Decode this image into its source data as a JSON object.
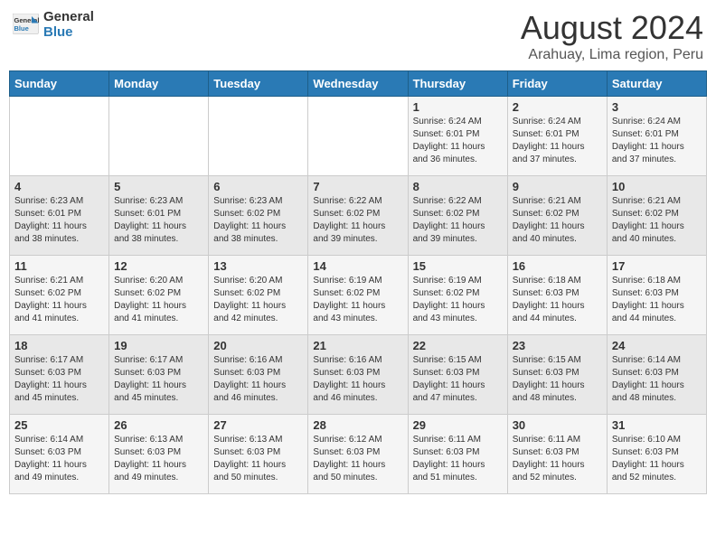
{
  "header": {
    "logo_general": "General",
    "logo_blue": "Blue",
    "month_title": "August 2024",
    "location": "Arahuay, Lima region, Peru"
  },
  "calendar": {
    "days_of_week": [
      "Sunday",
      "Monday",
      "Tuesday",
      "Wednesday",
      "Thursday",
      "Friday",
      "Saturday"
    ],
    "weeks": [
      [
        {
          "day": "",
          "info": ""
        },
        {
          "day": "",
          "info": ""
        },
        {
          "day": "",
          "info": ""
        },
        {
          "day": "",
          "info": ""
        },
        {
          "day": "1",
          "info": "Sunrise: 6:24 AM\nSunset: 6:01 PM\nDaylight: 11 hours\nand 36 minutes."
        },
        {
          "day": "2",
          "info": "Sunrise: 6:24 AM\nSunset: 6:01 PM\nDaylight: 11 hours\nand 37 minutes."
        },
        {
          "day": "3",
          "info": "Sunrise: 6:24 AM\nSunset: 6:01 PM\nDaylight: 11 hours\nand 37 minutes."
        }
      ],
      [
        {
          "day": "4",
          "info": "Sunrise: 6:23 AM\nSunset: 6:01 PM\nDaylight: 11 hours\nand 38 minutes."
        },
        {
          "day": "5",
          "info": "Sunrise: 6:23 AM\nSunset: 6:01 PM\nDaylight: 11 hours\nand 38 minutes."
        },
        {
          "day": "6",
          "info": "Sunrise: 6:23 AM\nSunset: 6:02 PM\nDaylight: 11 hours\nand 38 minutes."
        },
        {
          "day": "7",
          "info": "Sunrise: 6:22 AM\nSunset: 6:02 PM\nDaylight: 11 hours\nand 39 minutes."
        },
        {
          "day": "8",
          "info": "Sunrise: 6:22 AM\nSunset: 6:02 PM\nDaylight: 11 hours\nand 39 minutes."
        },
        {
          "day": "9",
          "info": "Sunrise: 6:21 AM\nSunset: 6:02 PM\nDaylight: 11 hours\nand 40 minutes."
        },
        {
          "day": "10",
          "info": "Sunrise: 6:21 AM\nSunset: 6:02 PM\nDaylight: 11 hours\nand 40 minutes."
        }
      ],
      [
        {
          "day": "11",
          "info": "Sunrise: 6:21 AM\nSunset: 6:02 PM\nDaylight: 11 hours\nand 41 minutes."
        },
        {
          "day": "12",
          "info": "Sunrise: 6:20 AM\nSunset: 6:02 PM\nDaylight: 11 hours\nand 41 minutes."
        },
        {
          "day": "13",
          "info": "Sunrise: 6:20 AM\nSunset: 6:02 PM\nDaylight: 11 hours\nand 42 minutes."
        },
        {
          "day": "14",
          "info": "Sunrise: 6:19 AM\nSunset: 6:02 PM\nDaylight: 11 hours\nand 43 minutes."
        },
        {
          "day": "15",
          "info": "Sunrise: 6:19 AM\nSunset: 6:02 PM\nDaylight: 11 hours\nand 43 minutes."
        },
        {
          "day": "16",
          "info": "Sunrise: 6:18 AM\nSunset: 6:03 PM\nDaylight: 11 hours\nand 44 minutes."
        },
        {
          "day": "17",
          "info": "Sunrise: 6:18 AM\nSunset: 6:03 PM\nDaylight: 11 hours\nand 44 minutes."
        }
      ],
      [
        {
          "day": "18",
          "info": "Sunrise: 6:17 AM\nSunset: 6:03 PM\nDaylight: 11 hours\nand 45 minutes."
        },
        {
          "day": "19",
          "info": "Sunrise: 6:17 AM\nSunset: 6:03 PM\nDaylight: 11 hours\nand 45 minutes."
        },
        {
          "day": "20",
          "info": "Sunrise: 6:16 AM\nSunset: 6:03 PM\nDaylight: 11 hours\nand 46 minutes."
        },
        {
          "day": "21",
          "info": "Sunrise: 6:16 AM\nSunset: 6:03 PM\nDaylight: 11 hours\nand 46 minutes."
        },
        {
          "day": "22",
          "info": "Sunrise: 6:15 AM\nSunset: 6:03 PM\nDaylight: 11 hours\nand 47 minutes."
        },
        {
          "day": "23",
          "info": "Sunrise: 6:15 AM\nSunset: 6:03 PM\nDaylight: 11 hours\nand 48 minutes."
        },
        {
          "day": "24",
          "info": "Sunrise: 6:14 AM\nSunset: 6:03 PM\nDaylight: 11 hours\nand 48 minutes."
        }
      ],
      [
        {
          "day": "25",
          "info": "Sunrise: 6:14 AM\nSunset: 6:03 PM\nDaylight: 11 hours\nand 49 minutes."
        },
        {
          "day": "26",
          "info": "Sunrise: 6:13 AM\nSunset: 6:03 PM\nDaylight: 11 hours\nand 49 minutes."
        },
        {
          "day": "27",
          "info": "Sunrise: 6:13 AM\nSunset: 6:03 PM\nDaylight: 11 hours\nand 50 minutes."
        },
        {
          "day": "28",
          "info": "Sunrise: 6:12 AM\nSunset: 6:03 PM\nDaylight: 11 hours\nand 50 minutes."
        },
        {
          "day": "29",
          "info": "Sunrise: 6:11 AM\nSunset: 6:03 PM\nDaylight: 11 hours\nand 51 minutes."
        },
        {
          "day": "30",
          "info": "Sunrise: 6:11 AM\nSunset: 6:03 PM\nDaylight: 11 hours\nand 52 minutes."
        },
        {
          "day": "31",
          "info": "Sunrise: 6:10 AM\nSunset: 6:03 PM\nDaylight: 11 hours\nand 52 minutes."
        }
      ]
    ]
  }
}
